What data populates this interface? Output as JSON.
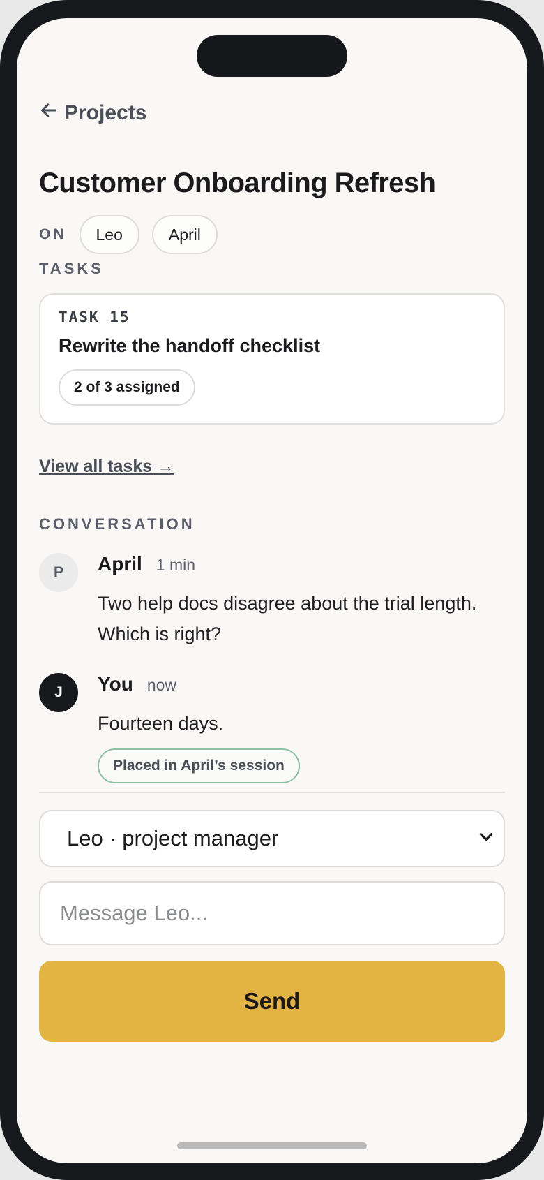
{
  "header": {
    "back_label": "Projects",
    "title": "Customer Onboarding Refresh"
  },
  "participants": {
    "label": "ON",
    "people": [
      "Leo",
      "April"
    ]
  },
  "tasks": {
    "section_label": "TASKS",
    "card": {
      "id": "TASK 15",
      "title": "Rewrite the handoff checklist",
      "assignment": "2 of 3 assigned"
    },
    "view_all": "View all tasks →"
  },
  "conversation": {
    "section_label": "CONVERSATION",
    "messages": [
      {
        "avatar_initial": "P",
        "author": "April",
        "time": "1 min",
        "text": "Two help docs disagree about the trial length. Which is right?"
      },
      {
        "avatar_initial": "J",
        "author": "You",
        "time": "now",
        "text": "Fourteen days.",
        "status": "Placed in April’s session"
      }
    ]
  },
  "composer": {
    "recipient": "Leo · project manager",
    "placeholder": "Message Leo...",
    "send_label": "Send"
  },
  "colors": {
    "accent": "#e4b443",
    "background": "#f9f8f6",
    "status_border": "#8fbfa6"
  },
  "icons": {
    "back": "arrow-left-icon",
    "dropdown": "chevron-down-icon"
  }
}
